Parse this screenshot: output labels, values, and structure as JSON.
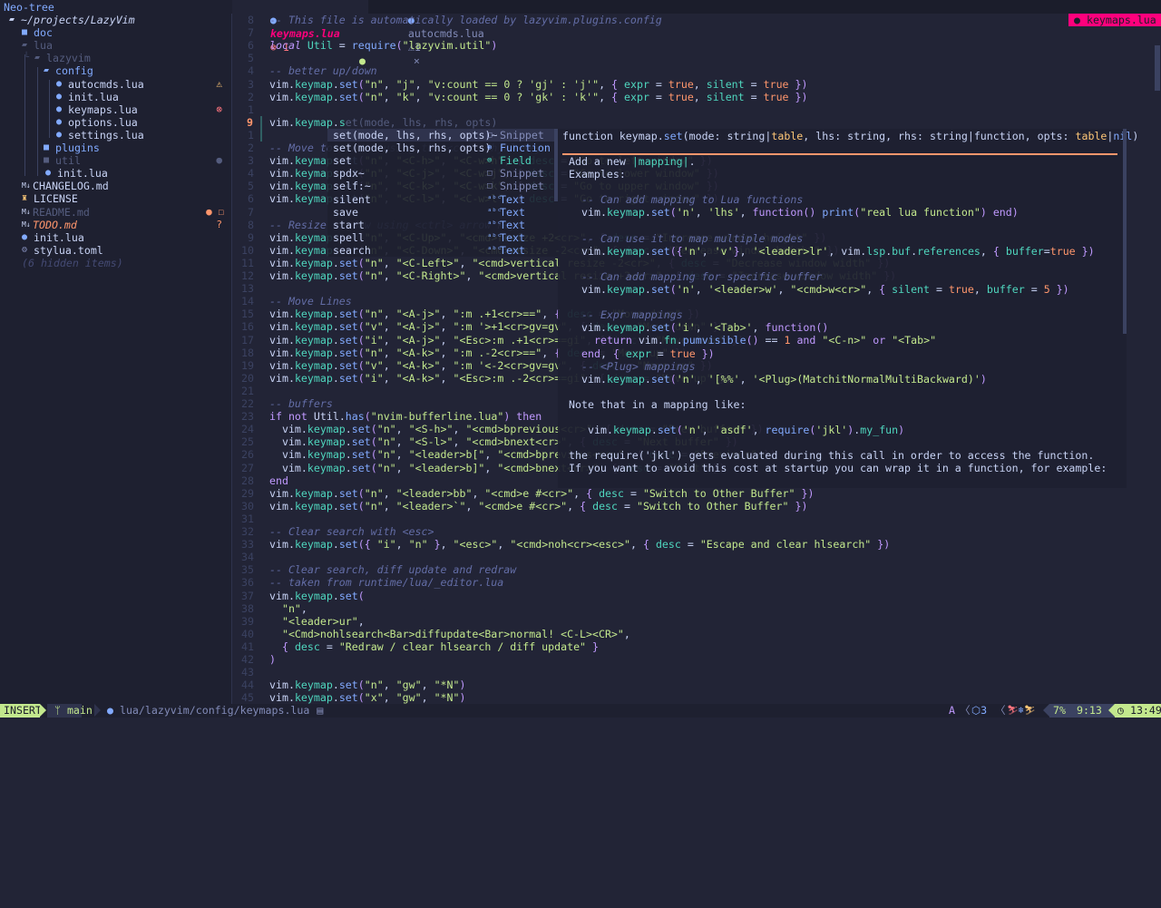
{
  "sidebar": {
    "title": "Neo-tree",
    "items": [
      {
        "label": "~/projects/LazyVim",
        "icon": "folder-open-icon",
        "indent": 10,
        "color": "#c8d3f5",
        "italic": true
      },
      {
        "label": "doc",
        "icon": "folder-icon",
        "indent": 24,
        "color": "#82aaff"
      },
      {
        "label": "lua",
        "icon": "folder-open-icon",
        "indent": 24,
        "color": "#545c7e"
      },
      {
        "label": "lazyvim",
        "icon": "folder-open-icon",
        "indent": 38,
        "color": "#545c7e",
        "guide": "└"
      },
      {
        "label": "config",
        "icon": "folder-open-icon",
        "indent": 48,
        "color": "#82aaff"
      },
      {
        "label": "autocmds.lua",
        "icon": "lua-icon",
        "indent": 62,
        "color": "#c8d3f5",
        "status": "⚠",
        "status_color": "#ffc777"
      },
      {
        "label": "init.lua",
        "icon": "lua-icon",
        "indent": 62,
        "color": "#c8d3f5"
      },
      {
        "label": "keymaps.lua",
        "icon": "lua-icon",
        "indent": 62,
        "color": "#c8d3f5",
        "status": "⊗",
        "status_color": "#ff757f"
      },
      {
        "label": "options.lua",
        "icon": "lua-icon",
        "indent": 62,
        "color": "#c8d3f5"
      },
      {
        "label": "settings.lua",
        "icon": "lua-icon",
        "indent": 62,
        "color": "#c8d3f5"
      },
      {
        "label": "plugins",
        "icon": "folder-icon",
        "indent": 48,
        "color": "#82aaff"
      },
      {
        "label": "util",
        "icon": "folder-icon",
        "indent": 48,
        "color": "#545c7e",
        "status": "●",
        "status_color": "#545c7e"
      },
      {
        "label": "init.lua",
        "icon": "lua-icon",
        "indent": 50,
        "color": "#c8d3f5"
      },
      {
        "label": "CHANGELOG.md",
        "icon": "markdown-icon",
        "indent": 24,
        "color": "#c8d3f5"
      },
      {
        "label": "LICENSE",
        "icon": "license-icon",
        "indent": 24,
        "color": "#c8d3f5"
      },
      {
        "label": "README.md",
        "icon": "markdown-icon",
        "indent": 24,
        "color": "#545c7e",
        "status": "● ☐",
        "status_color": "#ff966c"
      },
      {
        "label": "TODO.md",
        "icon": "markdown-icon",
        "indent": 24,
        "color": "#ff966c",
        "italic": true,
        "status": "?",
        "status_color": "#ff966c"
      },
      {
        "label": "init.lua",
        "icon": "lua-icon",
        "indent": 24,
        "color": "#c8d3f5"
      },
      {
        "label": "stylua.toml",
        "icon": "gear-icon",
        "indent": 24,
        "color": "#c8d3f5"
      },
      {
        "label": "(6 hidden items)",
        "icon": "",
        "indent": 24,
        "color": "#444a73",
        "italic": true
      }
    ]
  },
  "tabs": [
    {
      "label": "keymaps.lua",
      "diag": "⊗ 1",
      "modified": "●",
      "active": true
    },
    {
      "label": "autocmds.lua",
      "diag": "⚠1",
      "close": "×",
      "active": false
    }
  ],
  "winbar_badge": "keymaps.lua",
  "editor": {
    "lines": [
      {
        "n": "8",
        "t": "-- This file is automatically loaded by lazyvim.plugins.config"
      },
      {
        "n": "7",
        "t": ""
      },
      {
        "n": "6",
        "t": "local Util = require(\"lazyvim.util\")"
      },
      {
        "n": "5",
        "t": ""
      },
      {
        "n": "4",
        "t": "-- better up/down"
      },
      {
        "n": "3",
        "t": "vim.keymap.set(\"n\", \"j\", \"v:count == 0 ? 'gj' : 'j'\", { expr = true, silent = true })"
      },
      {
        "n": "2",
        "t": "vim.keymap.set(\"n\", \"k\", \"v:count == 0 ? 'gk' : 'k'\", { expr = true, silent = true })"
      },
      {
        "n": "1",
        "t": ""
      },
      {
        "n": "9",
        "t": "vim.keymap.s",
        "ghost": "et(mode, lhs, rhs, opts)",
        "current": true
      },
      {
        "n": "1",
        "t": ""
      },
      {
        "n": "2",
        "t": "-- Move to window using the <ctrl> hjkl keys"
      },
      {
        "n": "3",
        "t": "vim.keymap.set(\"n\", \"<C-h>\", \"<C-w>h\", { desc = \"Go to left window\" })"
      },
      {
        "n": "4",
        "t": "vim.keymap.set(\"n\", \"<C-j>\", \"<C-w>j\", { desc = \"Go to lower window\" })"
      },
      {
        "n": "5",
        "t": "vim.keymap.set(\"n\", \"<C-k>\", \"<C-w>k\", { desc = \"Go to upper window\" })"
      },
      {
        "n": "6",
        "t": "vim.keymap.set(\"n\", \"<C-l>\", \"<C-w>l\", { desc = \"Go to right window\" })"
      },
      {
        "n": "7",
        "t": ""
      },
      {
        "n": "8",
        "t": "-- Resize window using <ctrl> arrow keys"
      },
      {
        "n": "9",
        "t": "vim.keymap.set(\"n\", \"<C-Up>\", \"<cmd>resize +2<cr>\", { desc = \"Increase window height\" })"
      },
      {
        "n": "10",
        "t": "vim.keymap.set(\"n\", \"<C-Down>\", \"<cmd>resize -2<cr>\", { desc = \"Decrease window height\" })"
      },
      {
        "n": "11",
        "t": "vim.keymap.set(\"n\", \"<C-Left>\", \"<cmd>vertical resize -2<cr>\", { desc = \"Decrease window width\" })"
      },
      {
        "n": "12",
        "t": "vim.keymap.set(\"n\", \"<C-Right>\", \"<cmd>vertical resize +2<cr>\", { desc = \"Increase window width\" })"
      },
      {
        "n": "13",
        "t": ""
      },
      {
        "n": "14",
        "t": "-- Move Lines"
      },
      {
        "n": "15",
        "t": "vim.keymap.set(\"n\", \"<A-j>\", \":m .+1<cr>==\", { desc = \"Move down\" })"
      },
      {
        "n": "16",
        "t": "vim.keymap.set(\"v\", \"<A-j>\", \":m '>+1<cr>gv=gv\", { desc = \"Move down\" })"
      },
      {
        "n": "17",
        "t": "vim.keymap.set(\"i\", \"<A-j>\", \"<Esc>:m .+1<cr>==gi\", { desc = \"Move down\" })"
      },
      {
        "n": "18",
        "t": "vim.keymap.set(\"n\", \"<A-k>\", \":m .-2<cr>==\", { desc = \"Move up\" })"
      },
      {
        "n": "19",
        "t": "vim.keymap.set(\"v\", \"<A-k>\", \":m '<-2<cr>gv=gv\", { desc = \"Move up\" })"
      },
      {
        "n": "20",
        "t": "vim.keymap.set(\"i\", \"<A-k>\", \"<Esc>:m .-2<cr>==gi\", { desc = \"Move up\" })"
      },
      {
        "n": "21",
        "t": ""
      },
      {
        "n": "22",
        "t": "-- buffers"
      },
      {
        "n": "23",
        "t": "if not Util.has(\"nvim-bufferline.lua\") then"
      },
      {
        "n": "24",
        "t": "  vim.keymap.set(\"n\", \"<S-h>\", \"<cmd>bprevious<cr>\", { desc = \"Prev buffer\" })"
      },
      {
        "n": "25",
        "t": "  vim.keymap.set(\"n\", \"<S-l>\", \"<cmd>bnext<cr>\", { desc = \"Next buffer\" })"
      },
      {
        "n": "26",
        "t": "  vim.keymap.set(\"n\", \"<leader>b[\", \"<cmd>bprevious<cr>\", { desc = \"Previous\" })"
      },
      {
        "n": "27",
        "t": "  vim.keymap.set(\"n\", \"<leader>b]\", \"<cmd>bnext<cr>\", { desc = \"Next\" })"
      },
      {
        "n": "28",
        "t": "end"
      },
      {
        "n": "29",
        "t": "vim.keymap.set(\"n\", \"<leader>bb\", \"<cmd>e #<cr>\", { desc = \"Switch to Other Buffer\" })"
      },
      {
        "n": "30",
        "t": "vim.keymap.set(\"n\", \"<leader>`\", \"<cmd>e #<cr>\", { desc = \"Switch to Other Buffer\" })"
      },
      {
        "n": "31",
        "t": ""
      },
      {
        "n": "32",
        "t": "-- Clear search with <esc>"
      },
      {
        "n": "33",
        "t": "vim.keymap.set({ \"i\", \"n\" }, \"<esc>\", \"<cmd>noh<cr><esc>\", { desc = \"Escape and clear hlsearch\" })"
      },
      {
        "n": "34",
        "t": ""
      },
      {
        "n": "35",
        "t": "-- Clear search, diff update and redraw"
      },
      {
        "n": "36",
        "t": "-- taken from runtime/lua/_editor.lua"
      },
      {
        "n": "37",
        "t": "vim.keymap.set("
      },
      {
        "n": "38",
        "t": "  \"n\","
      },
      {
        "n": "39",
        "t": "  \"<leader>ur\","
      },
      {
        "n": "40",
        "t": "  \"<Cmd>nohlsearch<Bar>diffupdate<Bar>normal! <C-L><CR>\","
      },
      {
        "n": "41",
        "t": "  { desc = \"Redraw / clear hlsearch / diff update\" }"
      },
      {
        "n": "42",
        "t": ")"
      },
      {
        "n": "43",
        "t": ""
      },
      {
        "n": "44",
        "t": "vim.keymap.set(\"n\", \"gw\", \"*N\")"
      },
      {
        "n": "45",
        "t": "vim.keymap.set(\"x\", \"gw\", \"*N\")"
      }
    ]
  },
  "completion": [
    {
      "label": "set(mode, lhs, rhs, opts)~",
      "kind": "Snippet",
      "icon": "snippet-icon",
      "selected": true
    },
    {
      "label": "set(mode, lhs, rhs, opts)",
      "kind": "Function",
      "icon": "function-icon"
    },
    {
      "label": "set",
      "kind": "Field",
      "icon": "field-icon"
    },
    {
      "label": "spdx~",
      "kind": "Snippet",
      "icon": "snippet-icon"
    },
    {
      "label": "self:~",
      "kind": "Snippet",
      "icon": "snippet-icon"
    },
    {
      "label": "silent",
      "kind": "Text",
      "icon": "text-icon"
    },
    {
      "label": "save",
      "kind": "Text",
      "icon": "text-icon"
    },
    {
      "label": "start",
      "kind": "Text",
      "icon": "text-icon"
    },
    {
      "label": "spell",
      "kind": "Text",
      "icon": "text-icon"
    },
    {
      "label": "search",
      "kind": "Text",
      "icon": "text-icon"
    }
  ],
  "doc": {
    "signature": "function keymap.set(mode: string|table, lhs: string, rhs: string|function, opts: table|nil)",
    "lines": [
      {
        "t": "Add a new |mapping|.",
        "i": 0
      },
      {
        "t": "Examples:",
        "i": 0
      },
      {
        "t": "",
        "i": 0
      },
      {
        "t": "-- Can add mapping to Lua functions",
        "i": 2
      },
      {
        "t": "vim.keymap.set('n', 'lhs', function() print(\"real lua function\") end)",
        "i": 2
      },
      {
        "t": "",
        "i": 0
      },
      {
        "t": "-- Can use it to map multiple modes",
        "i": 2
      },
      {
        "t": "vim.keymap.set({'n', 'v'}, '<leader>lr', vim.lsp.buf.references, { buffer=true })",
        "i": 2
      },
      {
        "t": "",
        "i": 0
      },
      {
        "t": "-- Can add mapping for specific buffer",
        "i": 2
      },
      {
        "t": "vim.keymap.set('n', '<leader>w', \"<cmd>w<cr>\", { silent = true, buffer = 5 })",
        "i": 2
      },
      {
        "t": "",
        "i": 0
      },
      {
        "t": "-- Expr mappings",
        "i": 2
      },
      {
        "t": "vim.keymap.set('i', '<Tab>', function()",
        "i": 2
      },
      {
        "t": "return vim.fn.pumvisible() == 1 and \"<C-n>\" or \"<Tab>\"",
        "i": 4
      },
      {
        "t": "end, { expr = true })",
        "i": 2
      },
      {
        "t": "-- <Plug> mappings",
        "i": 2
      },
      {
        "t": "vim.keymap.set('n', '[%%', '<Plug>(MatchitNormalMultiBackward)')",
        "i": 2
      },
      {
        "t": "",
        "i": 0
      },
      {
        "t": "Note that in a mapping like:",
        "i": 0
      },
      {
        "t": "",
        "i": 0
      },
      {
        "t": "vim.keymap.set('n', 'asdf', require('jkl').my_fun)",
        "i": 3
      },
      {
        "t": "",
        "i": 0
      },
      {
        "t": "the require('jkl') gets evaluated during this call in order to access the function.",
        "i": 0
      },
      {
        "t": "If you want to avoid this cost at startup you can wrap it in a function, for example:",
        "i": 0
      }
    ]
  },
  "statusline": {
    "mode": "INSERT",
    "branch": "main",
    "path": "lua/lazyvim/config/keymaps.lua",
    "autopair": "A",
    "lsp_count": "3",
    "progress": "7%",
    "location": "9:13",
    "clock": "13:49"
  },
  "colors": {
    "accent": "#82aaff",
    "mode_bg": "#c3e88d",
    "badge": "#ff007c",
    "bg": "#222436"
  }
}
